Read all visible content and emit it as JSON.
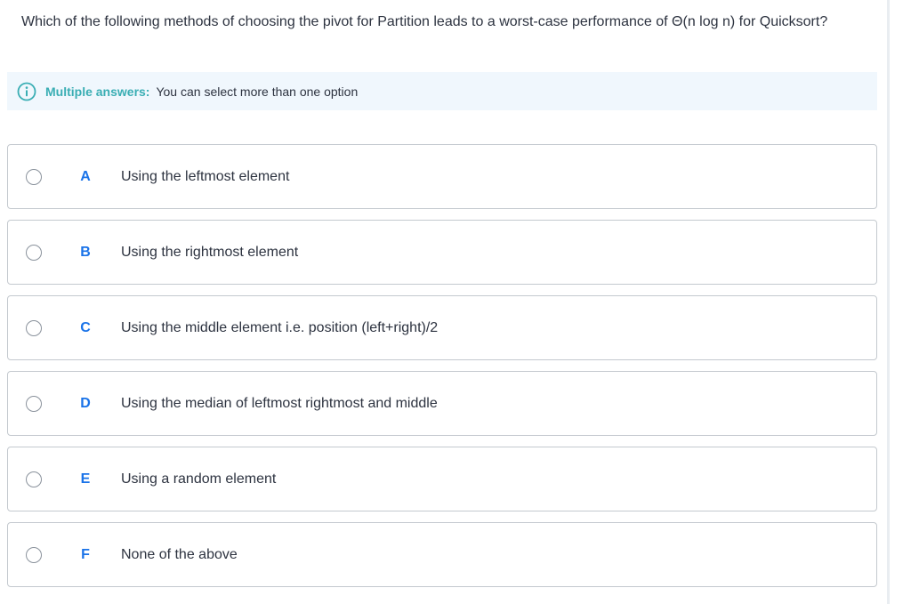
{
  "question": {
    "text": "Which of the following methods of choosing the pivot for Partition leads to a worst-case performance of Θ(n log n) for Quicksort?"
  },
  "notice": {
    "icon": "info-icon",
    "title": "Multiple answers:",
    "text": "You can select more than one option"
  },
  "options": [
    {
      "letter": "A",
      "text": "Using the leftmost element",
      "selected": false
    },
    {
      "letter": "B",
      "text": "Using the rightmost element",
      "selected": false
    },
    {
      "letter": "C",
      "text": "Using the middle element i.e. position (left+right)/2",
      "selected": false
    },
    {
      "letter": "D",
      "text": "Using the median of leftmost rightmost and middle",
      "selected": false
    },
    {
      "letter": "E",
      "text": "Using a random element",
      "selected": false
    },
    {
      "letter": "F",
      "text": "None of the above",
      "selected": false
    }
  ],
  "colors": {
    "accent": "#1a73e8",
    "notice_title": "#3aaeb4",
    "notice_bg": "#f0f7fd",
    "border": "#c4c9cf"
  }
}
